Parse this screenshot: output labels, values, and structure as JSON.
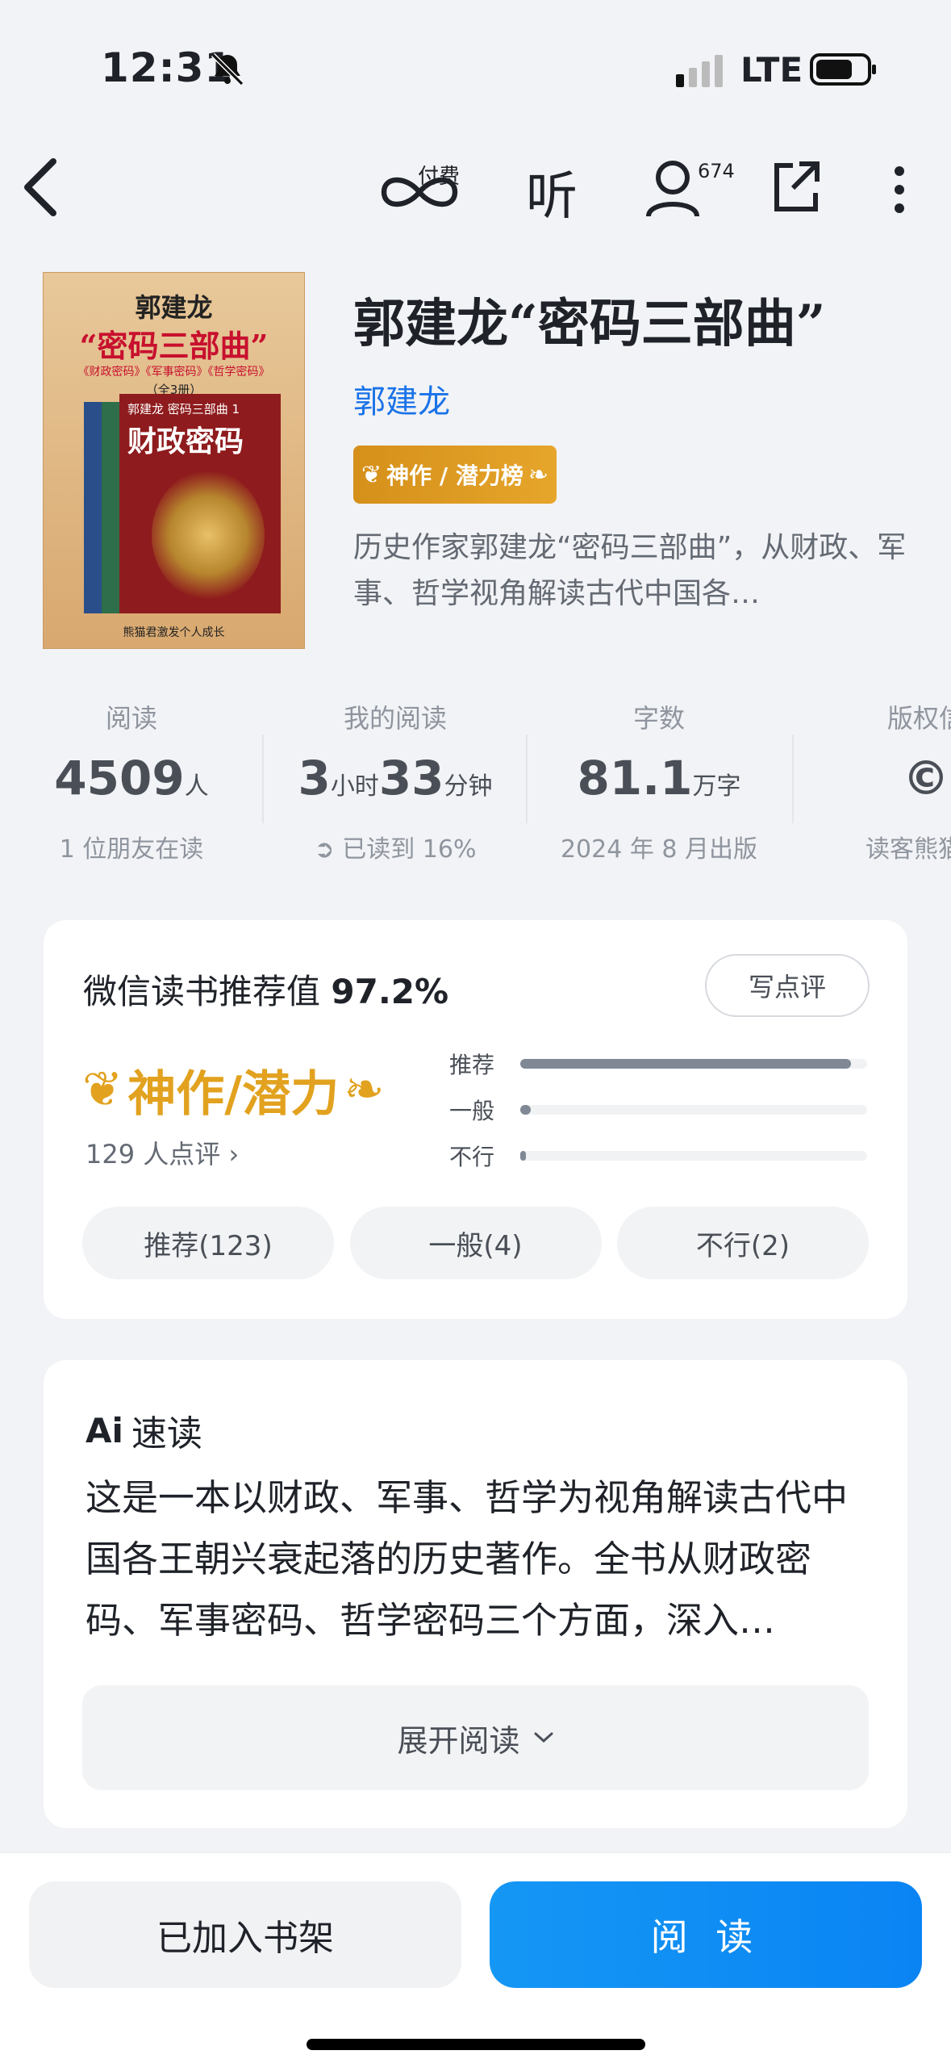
{
  "status_bar": {
    "time": "12:31",
    "network": "LTE"
  },
  "nav": {
    "pay_label": "付费",
    "listen_label": "听",
    "user_count": "674"
  },
  "book": {
    "title": "郭建龙“密码三部曲”",
    "author": "郭建龙",
    "rank_badge": "神作 / 潜力榜",
    "description": "历史作家郭建龙“密码三部曲”，从财政、军事、哲学视角解读古代中国各…",
    "cover": {
      "author": "郭建龙",
      "title": "“密码三部曲”",
      "subtitle": "《财政密码》《军事密码》《哲学密码》",
      "volumes": "（全3册）",
      "book_series": "郭建龙 密码三部曲 1",
      "book_title": "财政密码",
      "publisher": "熊猫君激发个人成长"
    }
  },
  "stats": [
    {
      "label": "阅读",
      "value": "4509",
      "unit": "人",
      "sub": "1 位朋友在读"
    },
    {
      "label": "我的阅读",
      "value": "3",
      "unit": "小时",
      "value2": "33",
      "unit2": "分钟",
      "sub": "已读到 16%"
    },
    {
      "label": "字数",
      "value": "81.1",
      "unit": "万字",
      "sub": "2024 年 8 月出版"
    },
    {
      "label": "版权信",
      "value": "©",
      "unit": "",
      "sub": "读客熊猫君"
    }
  ],
  "recommend": {
    "title": "微信读书推荐值",
    "percent": "97.2%",
    "write_button": "写点评",
    "badge": "神作/潜力",
    "review_count": "129 人点评",
    "bars": [
      {
        "label": "推荐",
        "ratio": 0.953
      },
      {
        "label": "一般",
        "ratio": 0.031
      },
      {
        "label": "不行",
        "ratio": 0.016
      }
    ],
    "buttons": [
      "推荐(123)",
      "一般(4)",
      "不行(2)"
    ]
  },
  "ai": {
    "mark": "Ai",
    "title": "速读",
    "text": "这是一本以财政、军事、哲学为视角解读古代中国各王朝兴衰起落的历史著作。全书从财政密码、军事密码、哲学密码三个方面，深入…",
    "expand": "展开阅读"
  },
  "bottom": {
    "shelf": "已加入书架",
    "read": "阅 读"
  },
  "colors": {
    "accent": "#1a73e8",
    "gold": "#e2a21f",
    "read_button": "#0a84f3"
  }
}
